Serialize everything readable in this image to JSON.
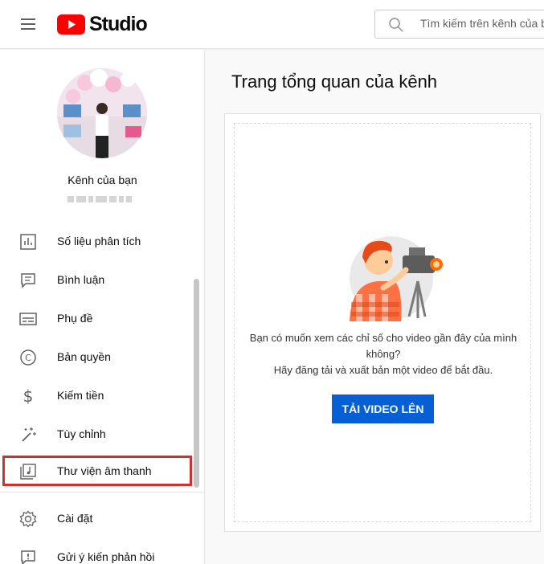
{
  "header": {
    "logo_text": "Studio",
    "search_placeholder": "Tìm kiếm trên kênh của bạn"
  },
  "sidebar": {
    "channel_label": "Kênh của bạn",
    "items": [
      {
        "label": "Số liệu phân tích",
        "icon": "analytics-icon"
      },
      {
        "label": "Bình luận",
        "icon": "comments-icon"
      },
      {
        "label": "Phụ đề",
        "icon": "subtitles-icon"
      },
      {
        "label": "Bản quyền",
        "icon": "copyright-icon"
      },
      {
        "label": "Kiếm tiền",
        "icon": "dollar-icon"
      },
      {
        "label": "Tùy chỉnh",
        "icon": "magic-wand-icon"
      },
      {
        "label": "Thư viện âm thanh",
        "icon": "audio-library-icon"
      },
      {
        "label": "Cài đặt",
        "icon": "gear-icon"
      },
      {
        "label": "Gửi ý kiến phản hồi",
        "icon": "feedback-icon"
      }
    ]
  },
  "main": {
    "title": "Trang tổng quan của kênh",
    "message_line1": "Bạn có muốn xem các chỉ số cho video gần đây của mình",
    "message_line2": "không?",
    "message_line3": "Hãy đăng tải và xuất bản một video để bắt đầu.",
    "upload_button": "TẢI VIDEO LÊN"
  },
  "colors": {
    "accent": "#065fd4",
    "youtube_red": "#ff0000",
    "highlight": "#d32f2f"
  }
}
